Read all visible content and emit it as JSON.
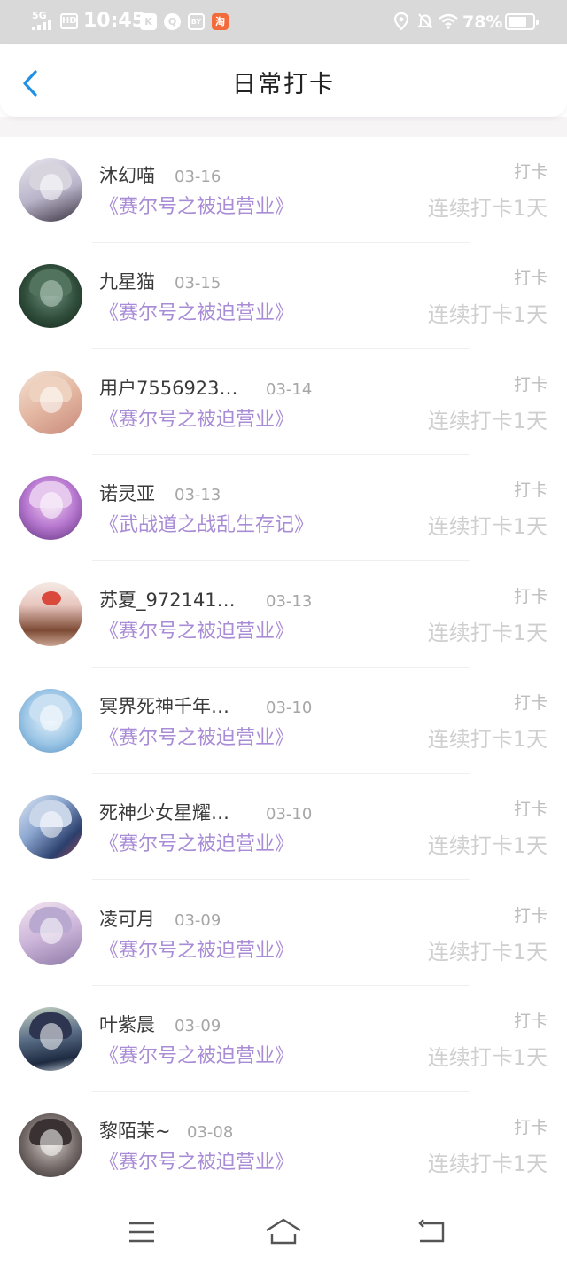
{
  "status_bar": {
    "network": "5G",
    "hd": "HD",
    "time": "10:45",
    "app_icons": [
      "K",
      "Q",
      "BY",
      "淘"
    ],
    "battery_percent": "78%",
    "battery_level": 0.78,
    "icons": [
      "location-icon",
      "bell-off-icon",
      "wifi-icon",
      "battery-icon"
    ]
  },
  "header": {
    "title": "日常打卡",
    "back_icon": "chevron-left-icon"
  },
  "colors": {
    "book_title": "#a98cd6",
    "back_arrow": "#1e90e6",
    "status_bar_bg": "#d9d9d9"
  },
  "checkins": [
    {
      "user": "沐幻喵",
      "date": "03-16",
      "book": "《赛尔号之被迫营业》",
      "label": "打卡",
      "streak": "连续打卡1天"
    },
    {
      "user": "九星猫",
      "date": "03-15",
      "book": "《赛尔号之被迫营业》",
      "label": "打卡",
      "streak": "连续打卡1天"
    },
    {
      "user": "用户7556923…",
      "date": "03-14",
      "book": "《赛尔号之被迫营业》",
      "label": "打卡",
      "streak": "连续打卡1天"
    },
    {
      "user": "诺灵亚",
      "date": "03-13",
      "book": "《武战道之战乱生存记》",
      "label": "打卡",
      "streak": "连续打卡1天"
    },
    {
      "user": "苏夏_972141…",
      "date": "03-13",
      "book": "《赛尔号之被迫营业》",
      "label": "打卡",
      "streak": "连续打卡1天"
    },
    {
      "user": "冥界死神千年…",
      "date": "03-10",
      "book": "《赛尔号之被迫营业》",
      "label": "打卡",
      "streak": "连续打卡1天"
    },
    {
      "user": "死神少女星耀…",
      "date": "03-10",
      "book": "《赛尔号之被迫营业》",
      "label": "打卡",
      "streak": "连续打卡1天"
    },
    {
      "user": "凌可月",
      "date": "03-09",
      "book": "《赛尔号之被迫营业》",
      "label": "打卡",
      "streak": "连续打卡1天"
    },
    {
      "user": "叶紫晨",
      "date": "03-09",
      "book": "《赛尔号之被迫营业》",
      "label": "打卡",
      "streak": "连续打卡1天"
    },
    {
      "user": "黎陌茉~",
      "date": "03-08",
      "book": "《赛尔号之被迫营业》",
      "label": "打卡",
      "streak": "连续打卡1天"
    }
  ],
  "nav_bar": {
    "icons": [
      "menu-icon",
      "home-icon",
      "back-icon"
    ]
  }
}
